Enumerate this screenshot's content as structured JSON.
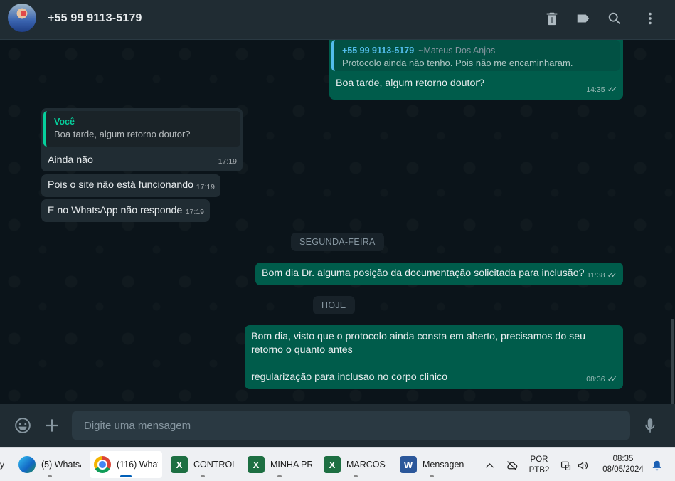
{
  "header": {
    "contact_name": "+55 99 9113-5179"
  },
  "messages": {
    "m1": {
      "quote_author": "+55 99 9113-5179",
      "quote_author_sub": "~Mateus Dos Anjos",
      "quote_text": "Protocolo ainda não tenho. Pois não me encaminharam.",
      "text": "Boa tarde, algum retorno doutor?",
      "time": "14:35"
    },
    "m2": {
      "quote_author": "Você",
      "quote_text": "Boa tarde, algum retorno doutor?",
      "text": "Ainda não",
      "time": "17:19"
    },
    "m3": {
      "text": "Pois o site não está funcionando",
      "time": "17:19"
    },
    "m4": {
      "text": "E no WhatsApp não responde",
      "time": "17:19"
    },
    "day1": "SEGUNDA-FEIRA",
    "m5": {
      "text": "Bom dia Dr. alguma posição da documentação solicitada para inclusão?",
      "time": "11:38"
    },
    "day2": "HOJE",
    "m6": {
      "line1": "Bom dia, visto que o protocolo ainda consta em aberto, precisamos do seu",
      "line2": "retorno o quanto antes",
      "line3": "regularização para inclusao no corpo clinico",
      "time": "08:36"
    }
  },
  "compose": {
    "placeholder": "Digite uma mensagem"
  },
  "taskbar": {
    "items": [
      {
        "label": "(5) WhatsA",
        "icon": "edge-icon"
      },
      {
        "label": "(116) What",
        "icon": "chrome-icon"
      },
      {
        "label": "CONTROLI",
        "icon": "excel-icon"
      },
      {
        "label": "MINHA PR",
        "icon": "excel-icon"
      },
      {
        "label": "MARCOS (",
        "icon": "excel-icon"
      },
      {
        "label": "Mensagen",
        "icon": "word-icon"
      }
    ],
    "lang1": "POR",
    "lang2": "PTB2",
    "clock_time": "08:35",
    "clock_date": "08/05/2024"
  },
  "colors": {
    "header_bg": "#202c33",
    "chat_bg": "#0b141a",
    "outgoing_bubble": "#005c4b",
    "incoming_bubble": "#202c33",
    "accent_green": "#06cf9c",
    "accent_blue": "#53bdeb"
  }
}
